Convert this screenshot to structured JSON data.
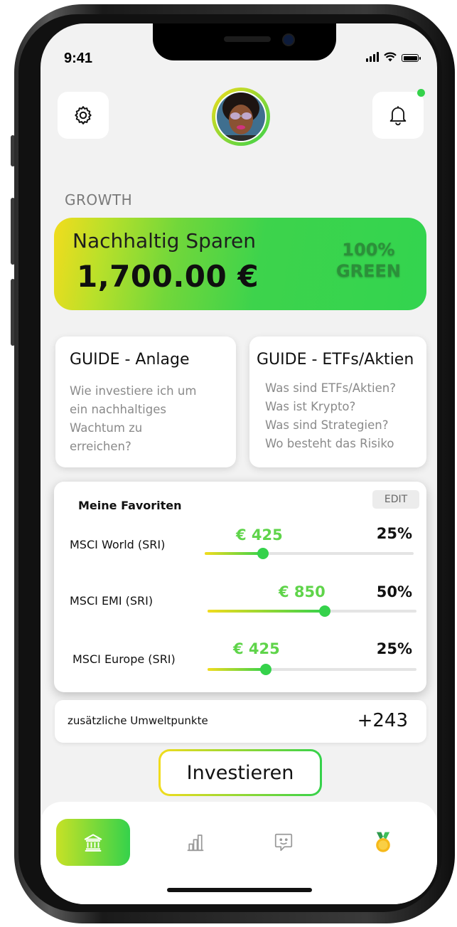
{
  "status_bar": {
    "time": "9:41"
  },
  "header": {
    "settings_icon": "gear-icon",
    "bell_icon": "bell-icon",
    "notification_dot_color": "#35d24b"
  },
  "section": {
    "label": "GROWTH"
  },
  "hero": {
    "title": "Nachhaltig Sparen",
    "amount": "1,700.00 €",
    "badge_line1": "100%",
    "badge_line2": "GREEN"
  },
  "guides": [
    {
      "title": "GUIDE - Anlage",
      "lines": [
        "Wie investiere ich um",
        "ein nachhaltiges",
        "Wachtum zu",
        "erreichen?"
      ]
    },
    {
      "title": "GUIDE - ETFs/Aktien",
      "lines": [
        "Was sind ETFs/Aktien?",
        "Was ist Krypto?",
        "Was sind Strategien?",
        "Wo besteht das Risiko"
      ]
    }
  ],
  "favorites": {
    "title": "Meine Favoriten",
    "edit_label": "EDIT",
    "items": [
      {
        "name": "MSCI World (SRI)",
        "amount": "€ 425",
        "percent": "25%",
        "slider_value": 0.25
      },
      {
        "name": "MSCI EMI (SRI)",
        "amount": "€ 850",
        "percent": "50%",
        "slider_value": 0.5
      },
      {
        "name": "MSCI Europe (SRI)",
        "amount": "€ 425",
        "percent": "25%",
        "slider_value": 0.25
      }
    ]
  },
  "eco_points": {
    "label": "zusätzliche Umweltpunkte",
    "value": "+243"
  },
  "cta": {
    "label": "Investieren"
  },
  "tabs": [
    {
      "icon": "bank-icon",
      "active": true
    },
    {
      "icon": "chart-icon",
      "active": false
    },
    {
      "icon": "chat-icon",
      "active": false
    },
    {
      "icon": "medal-icon",
      "active": false
    }
  ],
  "colors": {
    "accent_green": "#35d24b",
    "accent_yellow": "#f2dc1d",
    "amount_green": "#5fd44a"
  }
}
